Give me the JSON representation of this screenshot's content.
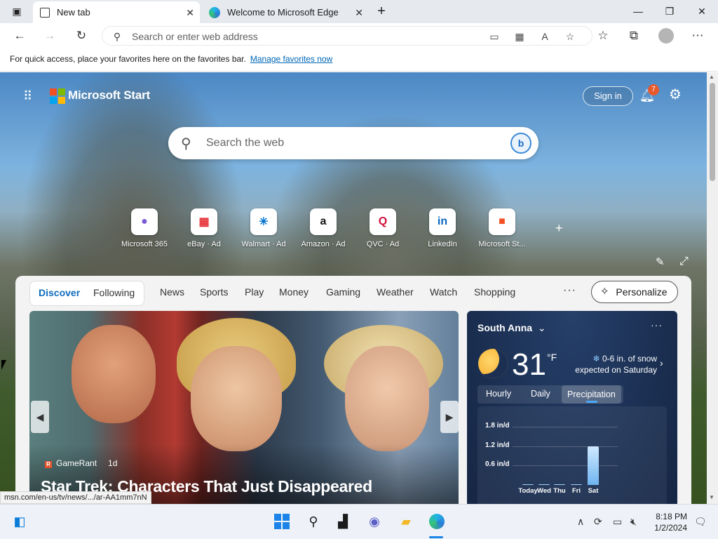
{
  "tabs": [
    {
      "title": "New tab",
      "active": true
    },
    {
      "title": "Welcome to Microsoft Edge",
      "active": false
    }
  ],
  "icons": {
    "tab_actions": "tab-actions-icon",
    "close": "close-icon",
    "new_tab": "plus-icon",
    "minimize": "minimize-icon",
    "restore": "restore-icon",
    "window_close": "window-close-icon",
    "back": "back-arrow-icon",
    "forward": "forward-arrow-icon",
    "refresh": "refresh-icon",
    "search": "search-icon",
    "apps": "app-launcher-icon",
    "bell": "bell-icon",
    "gear": "gear-icon"
  },
  "address": {
    "placeholder": "Search or enter web address"
  },
  "favbar": {
    "text": "For quick access, place your favorites here on the favorites bar.",
    "link": "Manage favorites now"
  },
  "msn": {
    "brand": "Microsoft Start",
    "signin": "Sign in",
    "notification_count": "7",
    "search_placeholder": "Search the web"
  },
  "quicklinks": [
    {
      "label": "Microsoft 365",
      "ad": false,
      "glyph": "●",
      "color": "#7b5cd6"
    },
    {
      "label": "eBay",
      "ad": true,
      "glyph": "▦",
      "color": "#e53238"
    },
    {
      "label": "Walmart",
      "ad": true,
      "glyph": "✳",
      "color": "#0071ce"
    },
    {
      "label": "Amazon",
      "ad": true,
      "glyph": "a",
      "color": "#111111"
    },
    {
      "label": "QVC",
      "ad": true,
      "glyph": "Q",
      "color": "#d0103a"
    },
    {
      "label": "LinkedIn",
      "ad": false,
      "glyph": "in",
      "color": "#0a66c2"
    },
    {
      "label": "Microsoft St...",
      "ad": false,
      "glyph": "■",
      "color": "#f25022"
    }
  ],
  "ad_label": "Ad",
  "feed": {
    "segments": [
      "Discover",
      "Following"
    ],
    "nav": [
      "News",
      "Sports",
      "Play",
      "Money",
      "Gaming",
      "Weather",
      "Watch",
      "Shopping"
    ],
    "more": "···",
    "personalize": "Personalize",
    "hero": {
      "source": "GameRant",
      "source_logo": "R",
      "time": "1d",
      "headline": "Star Trek: Characters That Just Disappeared"
    }
  },
  "weather": {
    "location": "South Anna",
    "temp": "31",
    "unit": "°F",
    "snow_line1": "0-6 in. of snow",
    "snow_line2": "expected on Saturday",
    "tabs": [
      "Hourly",
      "Daily",
      "Precipitation"
    ],
    "selected_tab": "Precipitation",
    "chart_data": {
      "type": "bar",
      "categories": [
        "Today",
        "Wed",
        "Thu",
        "Fri",
        "Sat"
      ],
      "values": [
        0,
        0,
        0,
        0,
        1.2
      ],
      "y_ticks": [
        "1.8 in/d",
        "1.2 in/d",
        "0.6 in/d"
      ],
      "ylim": [
        0,
        2.0
      ]
    }
  },
  "status_url": "msn.com/en-us/tv/news/.../ar-AA1mm7nN",
  "taskbar": {
    "time": "8:18 PM",
    "date": "1/2/2024"
  }
}
